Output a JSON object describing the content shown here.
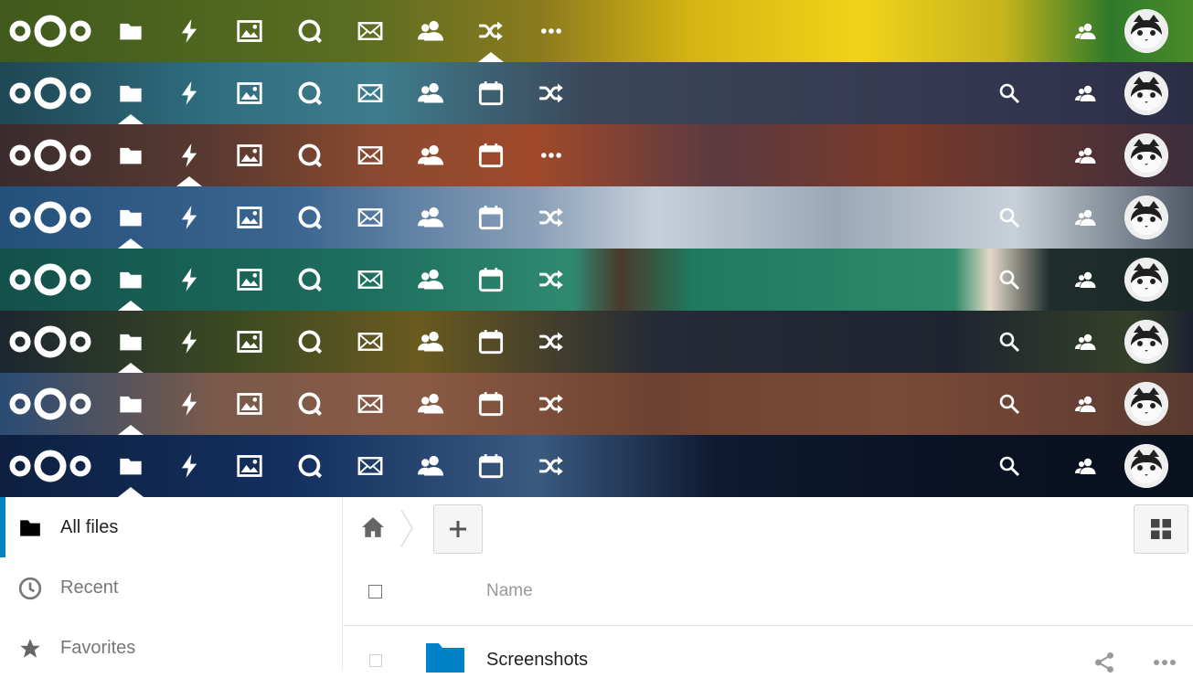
{
  "header_bars": [
    {
      "theme": "sunflower",
      "nav": [
        "files-icon",
        "activity-icon",
        "gallery-icon",
        "talk-icon",
        "mail-icon",
        "contacts-icon",
        "shuffle-icon",
        "more-icon"
      ],
      "active": "shuffle-icon",
      "search": false
    },
    {
      "theme": "fish",
      "nav": [
        "files-icon",
        "activity-icon",
        "gallery-icon",
        "talk-icon",
        "mail-icon",
        "contacts-icon",
        "calendar-icon",
        "shuffle-icon"
      ],
      "active": "files-icon",
      "search": true
    },
    {
      "theme": "volcano",
      "nav": [
        "files-icon",
        "activity-icon",
        "gallery-icon",
        "talk-icon",
        "mail-icon",
        "contacts-icon",
        "calendar-icon",
        "more-icon"
      ],
      "active": "activity-icon",
      "search": false
    },
    {
      "theme": "alps",
      "nav": [
        "files-icon",
        "activity-icon",
        "gallery-icon",
        "talk-icon",
        "mail-icon",
        "contacts-icon",
        "calendar-icon",
        "shuffle-icon"
      ],
      "active": "files-icon",
      "search": true
    },
    {
      "theme": "lake",
      "nav": [
        "files-icon",
        "activity-icon",
        "gallery-icon",
        "talk-icon",
        "mail-icon",
        "contacts-icon",
        "calendar-icon",
        "shuffle-icon"
      ],
      "active": "files-icon",
      "search": true
    },
    {
      "theme": "forest",
      "nav": [
        "files-icon",
        "activity-icon",
        "gallery-icon",
        "talk-icon",
        "mail-icon",
        "contacts-icon",
        "calendar-icon",
        "shuffle-icon"
      ],
      "active": "files-icon",
      "search": true
    },
    {
      "theme": "rocks",
      "nav": [
        "files-icon",
        "activity-icon",
        "gallery-icon",
        "talk-icon",
        "mail-icon",
        "contacts-icon",
        "calendar-icon",
        "shuffle-icon"
      ],
      "active": "files-icon",
      "search": true
    },
    {
      "theme": "waterfall",
      "nav": [
        "files-icon",
        "activity-icon",
        "gallery-icon",
        "talk-icon",
        "mail-icon",
        "contacts-icon",
        "calendar-icon",
        "shuffle-icon"
      ],
      "active": "files-icon",
      "search": true
    }
  ],
  "sidebar": {
    "items": [
      {
        "label": "All files",
        "icon": "folder-icon",
        "active": true
      },
      {
        "label": "Recent",
        "icon": "clock-icon",
        "active": false
      },
      {
        "label": "Favorites",
        "icon": "star-icon",
        "active": false
      }
    ]
  },
  "files": {
    "column_name": "Name",
    "rows": [
      {
        "name": "Screenshots",
        "type": "folder"
      }
    ]
  },
  "colors": {
    "accent": "#0082c9",
    "folder": "#0082c9"
  }
}
